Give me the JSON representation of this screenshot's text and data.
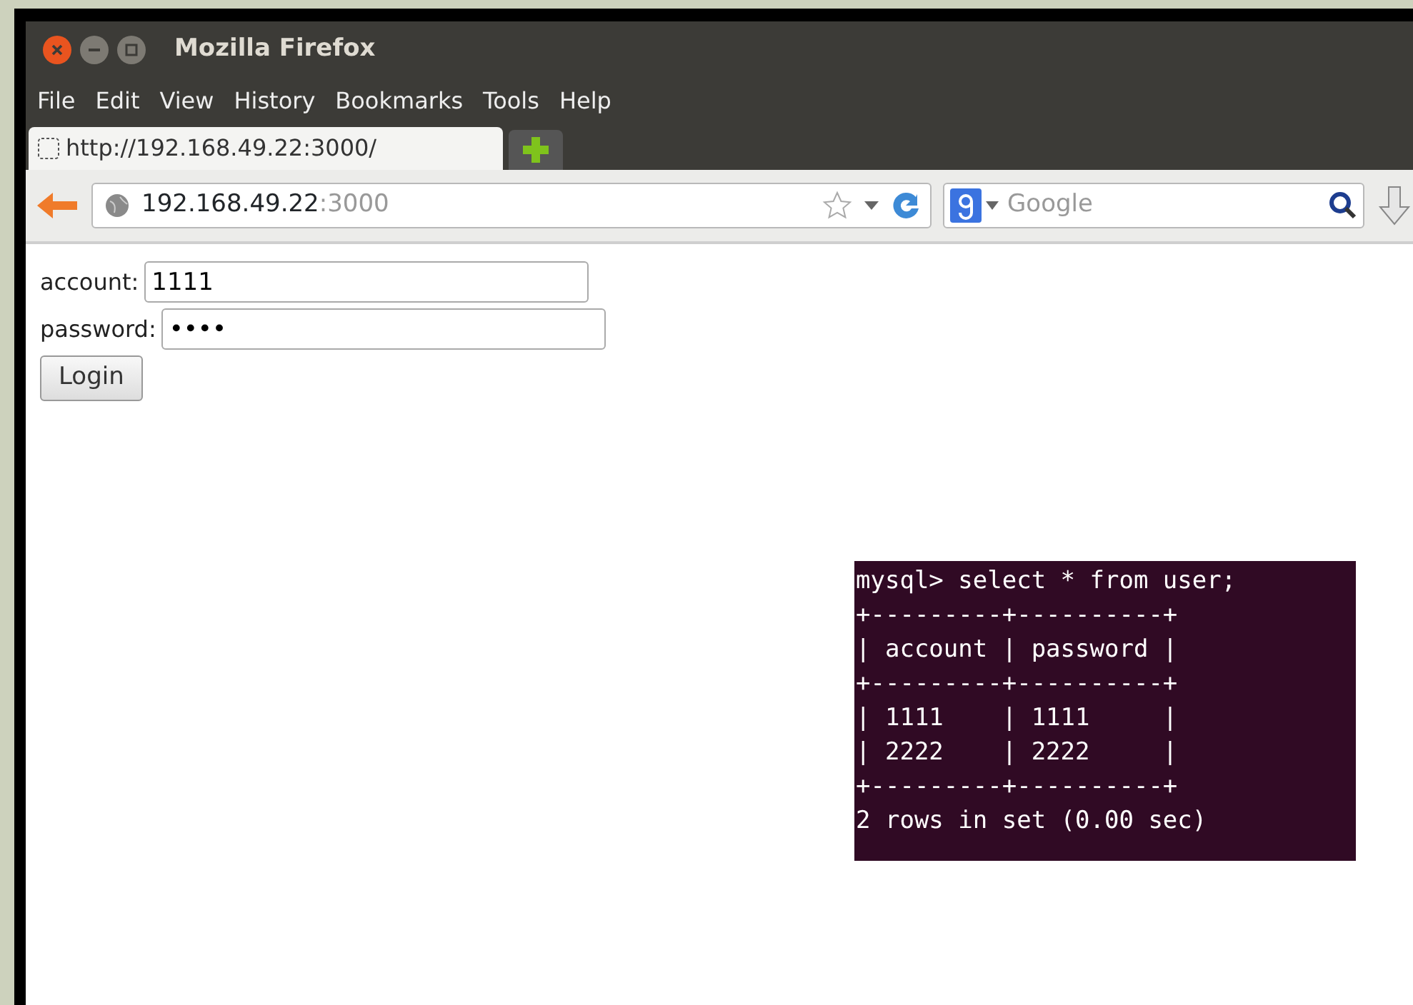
{
  "window": {
    "title": "Mozilla Firefox"
  },
  "menu": [
    {
      "label": "File"
    },
    {
      "label": "Edit"
    },
    {
      "label": "View"
    },
    {
      "label": "History"
    },
    {
      "label": "Bookmarks"
    },
    {
      "label": "Tools"
    },
    {
      "label": "Help"
    }
  ],
  "tabs": [
    {
      "label": "http://192.168.49.22:3000/",
      "selected": true
    }
  ],
  "address_bar": {
    "host": "192.168.49.22",
    "port": ":3000"
  },
  "search": {
    "placeholder": "Google"
  },
  "form": {
    "fields": [
      {
        "label": "account:",
        "value": "1111"
      },
      {
        "label": "password:",
        "value": "••••"
      }
    ],
    "button": "Login"
  },
  "terminal": {
    "lines": [
      "mysql> select * from user;",
      "+---------+----------+",
      "| account | password |",
      "+---------+----------+",
      "| 1111    | 1111     |",
      "| 2222    | 2222     |",
      "+---------+----------+",
      "2 rows in set (0.00 sec)"
    ]
  }
}
